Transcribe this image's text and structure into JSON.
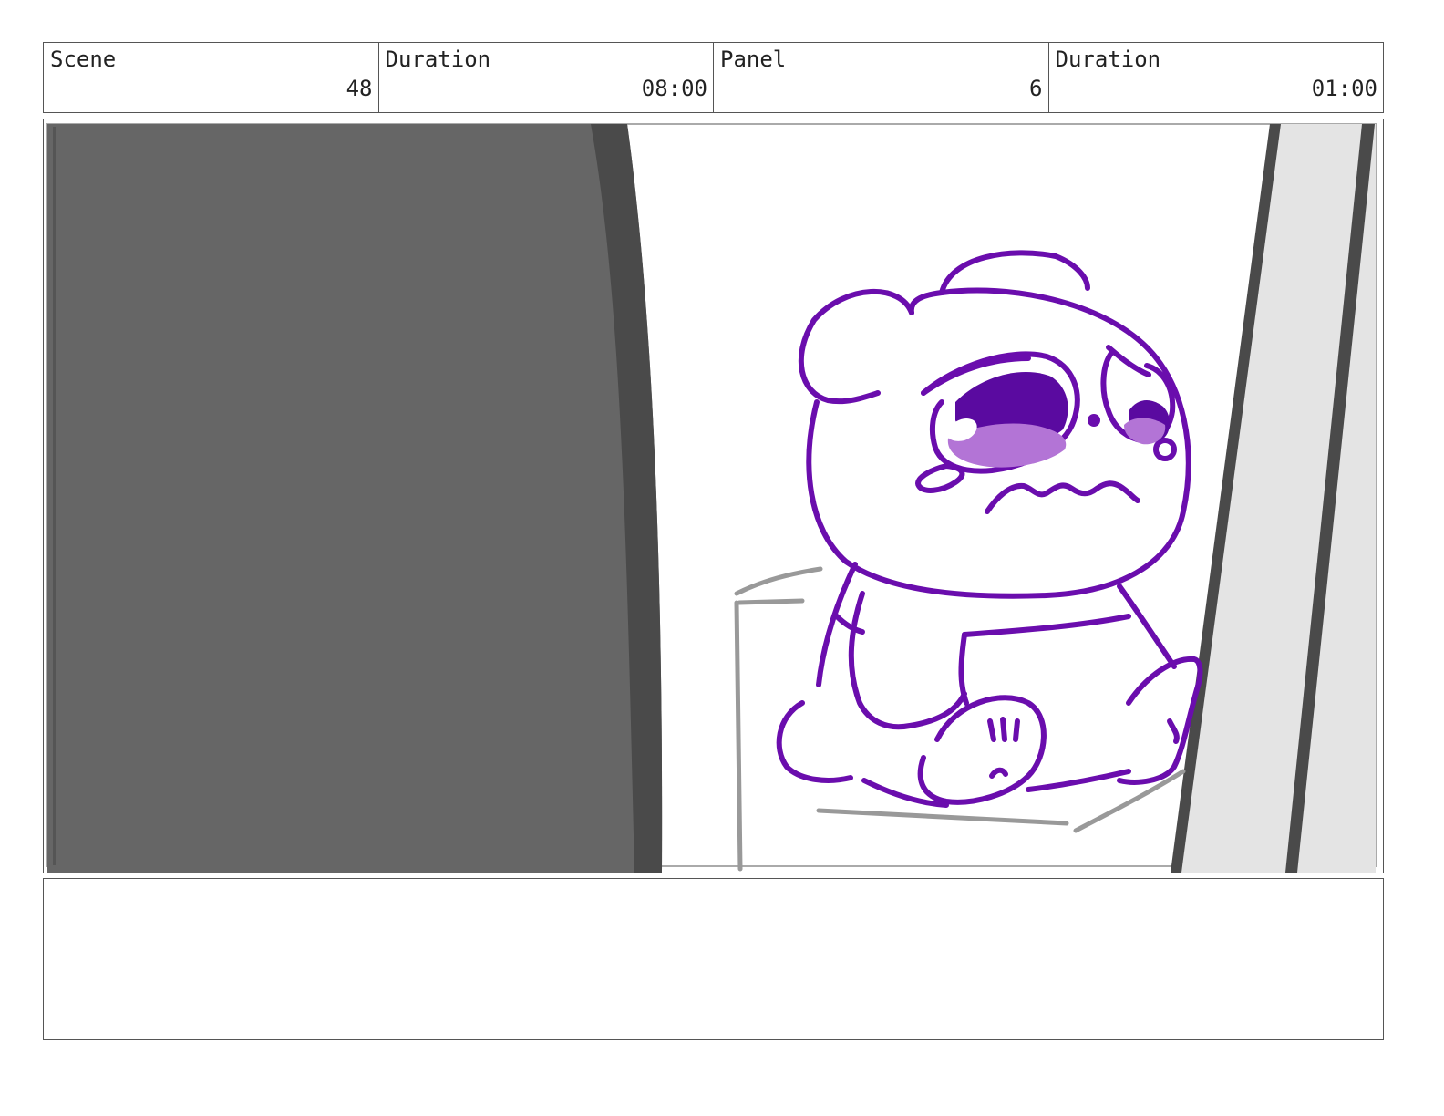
{
  "header": {
    "scene": {
      "label": "Scene",
      "value": "48"
    },
    "scene_duration": {
      "label": "Duration",
      "value": "08:00"
    },
    "panel": {
      "label": "Panel",
      "value": "6"
    },
    "panel_duration": {
      "label": "Duration",
      "value": "01:00"
    }
  },
  "notes": {
    "text": ""
  },
  "colors": {
    "line_art": "#6a0dad",
    "eye_fill": "#5a0aa0",
    "eye_highlight": "#b374d6",
    "door_dark": "#666666",
    "door_edge": "#4a4a4a",
    "prop_gray": "#999999",
    "wall_light": "#e4e4e4"
  }
}
